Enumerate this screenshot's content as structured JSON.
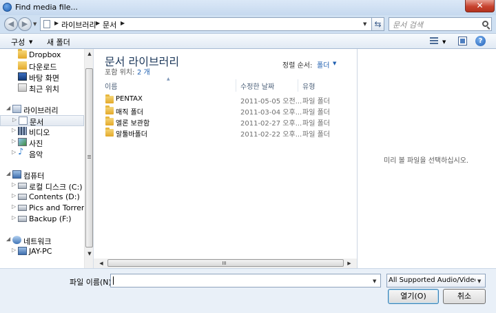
{
  "window": {
    "title": "Find media file...",
    "close_label": "✕"
  },
  "address": {
    "crumbs": [
      "라이브러리",
      "문서"
    ],
    "search_placeholder": "문서 검색"
  },
  "toolbar": {
    "organize_label": "구성",
    "new_folder_label": "새 폴더"
  },
  "nav": {
    "favorites": [
      {
        "label": "Dropbox",
        "icon": "dropbox-folder-icon"
      },
      {
        "label": "다운로드",
        "icon": "downloads-folder-icon"
      },
      {
        "label": "바탕 화면",
        "icon": "desktop-icon"
      },
      {
        "label": "최근 위치",
        "icon": "recent-places-icon"
      }
    ],
    "libraries_label": "라이브러리",
    "libraries": [
      {
        "label": "문서",
        "icon": "documents-library-icon",
        "selected": true
      },
      {
        "label": "비디오",
        "icon": "videos-library-icon"
      },
      {
        "label": "사진",
        "icon": "pictures-library-icon"
      },
      {
        "label": "음악",
        "icon": "music-library-icon"
      }
    ],
    "computer_label": "컴퓨터",
    "drives": [
      {
        "label": "로컬 디스크 (C:)"
      },
      {
        "label": "Contents (D:)"
      },
      {
        "label": "Pics and Torrents (E:"
      },
      {
        "label": "Backup (F:)"
      }
    ],
    "network_label": "네트워크",
    "network_items": [
      {
        "label": "JAY-PC"
      }
    ]
  },
  "library": {
    "title": "문서 라이브러리",
    "includes_label": "포함 위치:",
    "includes_count": "2 개",
    "arrange_label": "정렬 순서:",
    "arrange_value": "폴더"
  },
  "columns": {
    "name": "이름",
    "date": "수정한 날짜",
    "type": "유형"
  },
  "files": [
    {
      "name": "PENTAX",
      "date": "2011-05-05 오전...",
      "type": "파일 폴더"
    },
    {
      "name": "매직 폴더",
      "date": "2011-03-04 오후...",
      "type": "파일 폴더"
    },
    {
      "name": "엘론 보관함",
      "date": "2011-02-27 오후...",
      "type": "파일 폴더"
    },
    {
      "name": "알툴바폴더",
      "date": "2011-02-22 오후...",
      "type": "파일 폴더"
    }
  ],
  "preview": {
    "message": "미리 볼 파일을 선택하십시오."
  },
  "bottom": {
    "filename_label": "파일 이름(N):",
    "filename_value": "",
    "filter_value": "All Supported Audio/Video Files",
    "open_label": "열기(O)",
    "cancel_label": "취소"
  }
}
